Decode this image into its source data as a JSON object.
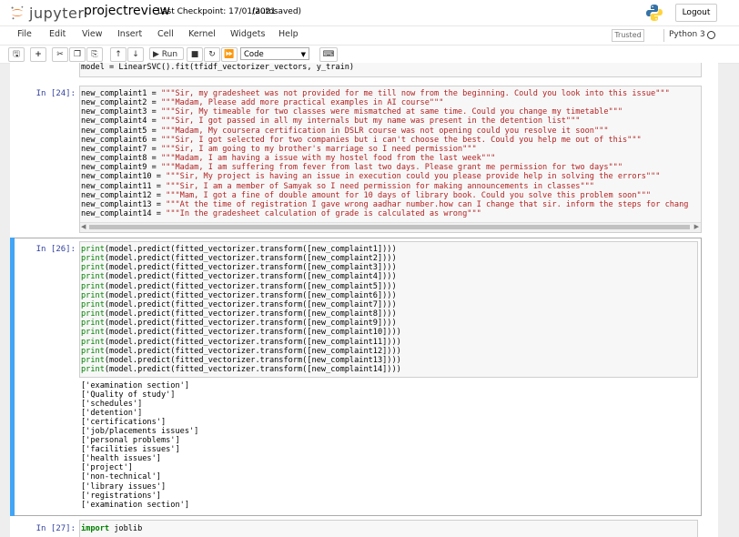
{
  "header": {
    "logo_text": "jupyter",
    "notebook_name": "projectreview",
    "checkpoint": "Last Checkpoint: 17/01/2021",
    "autosave_status": "(autosaved)",
    "logout_label": "Logout"
  },
  "menu": {
    "items": [
      "File",
      "Edit",
      "View",
      "Insert",
      "Cell",
      "Kernel",
      "Widgets",
      "Help"
    ],
    "trusted": "Trusted",
    "kernel_name": "Python 3"
  },
  "toolbar": {
    "run_label": "Run",
    "cell_type": "Code"
  },
  "cells": {
    "prev_line": "model = LinearSVC().fit(tfidf_vectorizer_vectors, y_train)",
    "cell24": {
      "prompt": "In [24]:",
      "lines": [
        {
          "var": "new_complaint1",
          "str": "\"\"\"Sir, my gradesheet was not provided for me till now from the beginning. Could you look into this issue\"\"\""
        },
        {
          "var": "new_complaint2",
          "str": "\"\"\"Madam, Please add more practical examples in AI course\"\"\""
        },
        {
          "var": "new_complaint3",
          "str": "\"\"\"Sir, My timeable for two classes were mismatched at same time. Could you change my timetable\"\"\""
        },
        {
          "var": "new_complaint4",
          "str": "\"\"\"Sir, I got passed in all my internals but my name was present in the detention list\"\"\""
        },
        {
          "var": "new_complaint5",
          "str": "\"\"\"Madam, My coursera certification in DSLR course was not opening could you resolve it soon\"\"\""
        },
        {
          "var": "new_complaint6",
          "str": "\"\"\"Sir, I got selected for two companies but i can't choose the best. Could you help me out of this\"\"\""
        },
        {
          "var": "new_complaint7",
          "str": "\"\"\"Sir, I am going to my brother's marriage so I need permission\"\"\""
        },
        {
          "var": "new_complaint8",
          "str": "\"\"\"Madam, I am having a issue with my hostel food from the last week\"\"\""
        },
        {
          "var": "new_complaint9",
          "str": "\"\"\"Madam, I am suffering from fever from last two days. Please grant me permission for two days\"\"\""
        },
        {
          "var": "new_complaint10",
          "str": "\"\"\"Sir, My project is having an issue in execution could you please provide help in solving the errors\"\"\""
        },
        {
          "var": "new_complaint11",
          "str": "\"\"\"Sir, I am a member of Samyak so I need permission for making announcements in classes\"\"\""
        },
        {
          "var": "new_complaint12",
          "str": "\"\"\"Mam, I got a fine of double amount for 10 days of library book. Could you solve this problem soon\"\"\""
        },
        {
          "var": "new_complaint13",
          "str": "\"\"\"At the time of registration I gave wrong aadhar number.how can I change that sir. inform the steps for chang"
        },
        {
          "var": "new_complaint14",
          "str": "\"\"\"In the gradesheet calculation of grade is calculated as wrong\"\"\""
        }
      ]
    },
    "cell26": {
      "prompt": "In [26]:",
      "lines": [
        "print(model.predict(fitted_vectorizer.transform([new_complaint1])))",
        "print(model.predict(fitted_vectorizer.transform([new_complaint2])))",
        "print(model.predict(fitted_vectorizer.transform([new_complaint3])))",
        "print(model.predict(fitted_vectorizer.transform([new_complaint4])))",
        "print(model.predict(fitted_vectorizer.transform([new_complaint5])))",
        "print(model.predict(fitted_vectorizer.transform([new_complaint6])))",
        "print(model.predict(fitted_vectorizer.transform([new_complaint7])))",
        "print(model.predict(fitted_vectorizer.transform([new_complaint8])))",
        "print(model.predict(fitted_vectorizer.transform([new_complaint9])))",
        "print(model.predict(fitted_vectorizer.transform([new_complaint10])))",
        "print(model.predict(fitted_vectorizer.transform([new_complaint11])))",
        "print(model.predict(fitted_vectorizer.transform([new_complaint12])))",
        "print(model.predict(fitted_vectorizer.transform([new_complaint13])))",
        "print(model.predict(fitted_vectorizer.transform([new_complaint14])))"
      ],
      "output": [
        "['examination section']",
        "['Quality of study']",
        "['schedules']",
        "['detention']",
        "['certifications']",
        "['job/placements issues']",
        "['personal problems']",
        "['facilities issues']",
        "['health issues']",
        "['project']",
        "['non-technical']",
        "['library issues']",
        "['registrations']",
        "['examination section']"
      ]
    },
    "cell27": {
      "prompt": "In [27]:",
      "keyword": "import",
      "rest": " joblib"
    }
  }
}
